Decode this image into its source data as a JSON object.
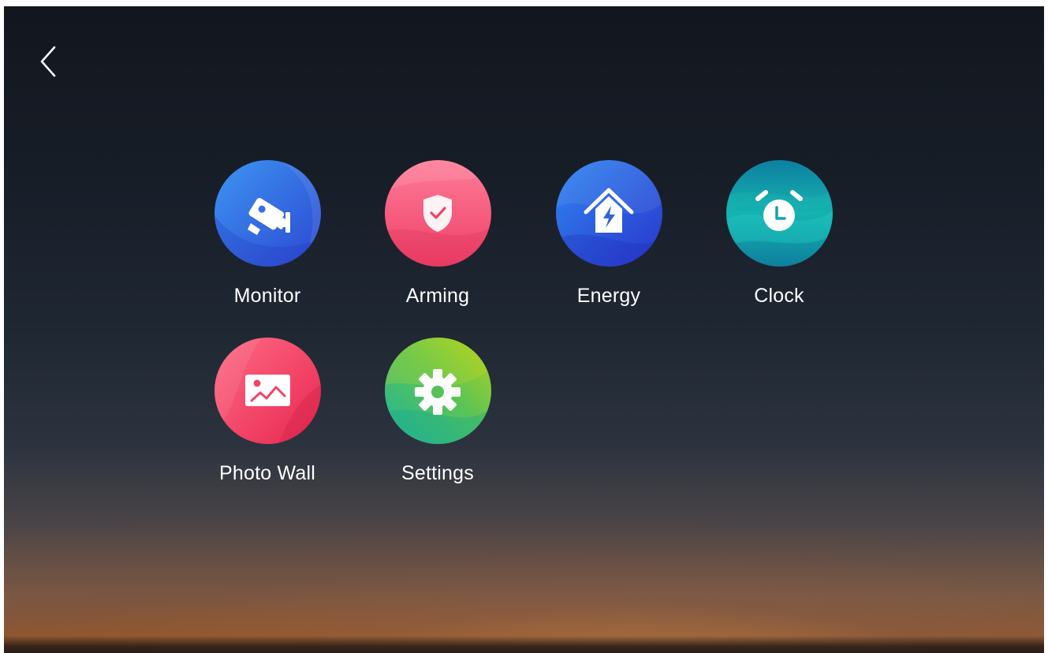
{
  "screen": {
    "back": {
      "icon": "chevron-left-icon"
    }
  },
  "apps": [
    {
      "id": "monitor",
      "label": "Monitor",
      "icon": "security-camera-icon",
      "colors": [
        "#3a8ef0",
        "#2f4fd6"
      ]
    },
    {
      "id": "arming",
      "label": "Arming",
      "icon": "shield-check-icon",
      "colors": [
        "#ff6f8e",
        "#f0456b"
      ]
    },
    {
      "id": "energy",
      "label": "Energy",
      "icon": "house-lightning-icon",
      "colors": [
        "#2e7cf0",
        "#2b3fd0"
      ]
    },
    {
      "id": "clock",
      "label": "Clock",
      "icon": "alarm-clock-icon",
      "colors": [
        "#17c3b9",
        "#0d7f9c"
      ]
    },
    {
      "id": "photo_wall",
      "label": "Photo Wall",
      "icon": "picture-icon",
      "colors": [
        "#ff5a7a",
        "#ea2e55"
      ]
    },
    {
      "id": "settings",
      "label": "Settings",
      "icon": "gear-icon",
      "colors": [
        "#a6d31e",
        "#2cb89a"
      ]
    }
  ]
}
